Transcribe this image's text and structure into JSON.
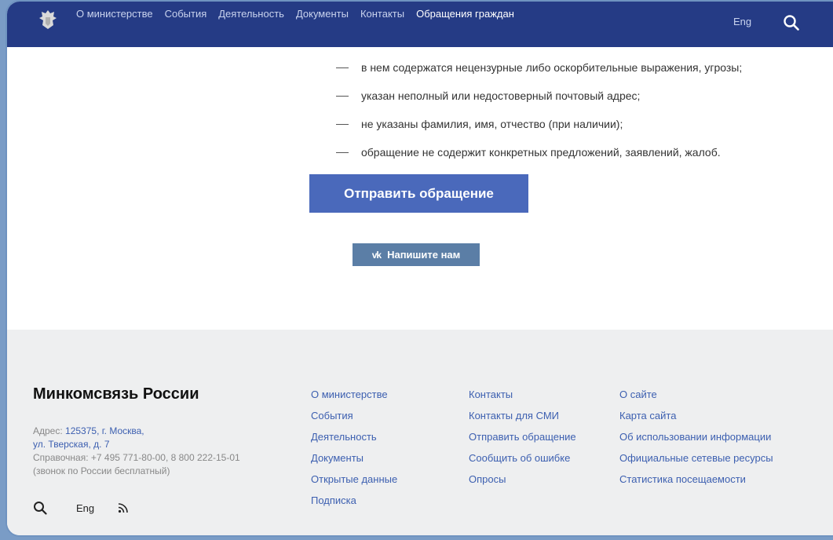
{
  "nav": {
    "items": [
      {
        "label": "О министерстве",
        "active": false
      },
      {
        "label": "События",
        "active": false
      },
      {
        "label": "Деятельность",
        "active": false
      },
      {
        "label": "Документы",
        "active": false
      },
      {
        "label": "Контакты",
        "active": false
      },
      {
        "label": "Обращения граждан",
        "active": true
      }
    ],
    "lang": "Eng"
  },
  "bullets": [
    "в нем содержатся нецензурные либо оскорбительные выражения, угрозы;",
    "указан неполный или недостоверный почтовый адрес;",
    "не указаны фамилия, имя, отчество (при наличии);",
    "обращение не содержит конкретных предложений, заявлений, жалоб."
  ],
  "send_button": "Отправить обращение",
  "vk_button": {
    "icon_text": "vk",
    "label": "Напишите нам"
  },
  "footer": {
    "brand": "Минкомсвязь России",
    "address_label": "Адрес: ",
    "address_line1": "125375, г. Москва,",
    "address_line2": "ул. Тверская, д. 7",
    "phone": "Справочная: +7 495 771-80-00, 8 800 222-15-01",
    "phone_note": "(звонок по России бесплатный)",
    "lang": "Eng",
    "col1": [
      "О министерстве",
      "События",
      "Деятельность",
      "Документы",
      "Открытые данные",
      "Подписка"
    ],
    "col2": [
      "Контакты",
      "Контакты для СМИ",
      "Отправить обращение",
      "Сообщить об ошибке",
      "Опросы"
    ],
    "col3": [
      "О сайте",
      "Карта сайта",
      "Об использовании информации",
      "Официальные сетевые ресурсы",
      "Статистика посещаемости"
    ]
  },
  "colors": {
    "header": "#253b85",
    "primary_button": "#4a69bb",
    "vk_button": "#5b7ea6",
    "link": "#3c5fb0",
    "footer_bg": "#eeeff0"
  }
}
